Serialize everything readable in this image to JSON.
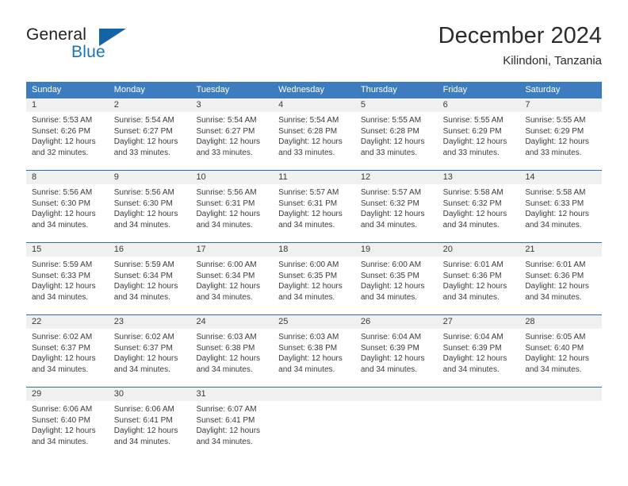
{
  "brand": {
    "name_part1": "General",
    "name_part2": "Blue",
    "triangle_color": "#1364a5",
    "blue_color": "#1a72bb"
  },
  "header": {
    "month_title": "December 2024",
    "location": "Kilindoni, Tanzania"
  },
  "calendar": {
    "header_bg": "#3d7dbf",
    "daynum_bg": "#f0f0f0",
    "row_divider": "#2f6daf",
    "weekdays": [
      "Sunday",
      "Monday",
      "Tuesday",
      "Wednesday",
      "Thursday",
      "Friday",
      "Saturday"
    ],
    "weeks": [
      [
        {
          "day": "1",
          "sunrise": "Sunrise: 5:53 AM",
          "sunset": "Sunset: 6:26 PM",
          "daylight_line1": "Daylight: 12 hours",
          "daylight_line2": "and 32 minutes."
        },
        {
          "day": "2",
          "sunrise": "Sunrise: 5:54 AM",
          "sunset": "Sunset: 6:27 PM",
          "daylight_line1": "Daylight: 12 hours",
          "daylight_line2": "and 33 minutes."
        },
        {
          "day": "3",
          "sunrise": "Sunrise: 5:54 AM",
          "sunset": "Sunset: 6:27 PM",
          "daylight_line1": "Daylight: 12 hours",
          "daylight_line2": "and 33 minutes."
        },
        {
          "day": "4",
          "sunrise": "Sunrise: 5:54 AM",
          "sunset": "Sunset: 6:28 PM",
          "daylight_line1": "Daylight: 12 hours",
          "daylight_line2": "and 33 minutes."
        },
        {
          "day": "5",
          "sunrise": "Sunrise: 5:55 AM",
          "sunset": "Sunset: 6:28 PM",
          "daylight_line1": "Daylight: 12 hours",
          "daylight_line2": "and 33 minutes."
        },
        {
          "day": "6",
          "sunrise": "Sunrise: 5:55 AM",
          "sunset": "Sunset: 6:29 PM",
          "daylight_line1": "Daylight: 12 hours",
          "daylight_line2": "and 33 minutes."
        },
        {
          "day": "7",
          "sunrise": "Sunrise: 5:55 AM",
          "sunset": "Sunset: 6:29 PM",
          "daylight_line1": "Daylight: 12 hours",
          "daylight_line2": "and 33 minutes."
        }
      ],
      [
        {
          "day": "8",
          "sunrise": "Sunrise: 5:56 AM",
          "sunset": "Sunset: 6:30 PM",
          "daylight_line1": "Daylight: 12 hours",
          "daylight_line2": "and 34 minutes."
        },
        {
          "day": "9",
          "sunrise": "Sunrise: 5:56 AM",
          "sunset": "Sunset: 6:30 PM",
          "daylight_line1": "Daylight: 12 hours",
          "daylight_line2": "and 34 minutes."
        },
        {
          "day": "10",
          "sunrise": "Sunrise: 5:56 AM",
          "sunset": "Sunset: 6:31 PM",
          "daylight_line1": "Daylight: 12 hours",
          "daylight_line2": "and 34 minutes."
        },
        {
          "day": "11",
          "sunrise": "Sunrise: 5:57 AM",
          "sunset": "Sunset: 6:31 PM",
          "daylight_line1": "Daylight: 12 hours",
          "daylight_line2": "and 34 minutes."
        },
        {
          "day": "12",
          "sunrise": "Sunrise: 5:57 AM",
          "sunset": "Sunset: 6:32 PM",
          "daylight_line1": "Daylight: 12 hours",
          "daylight_line2": "and 34 minutes."
        },
        {
          "day": "13",
          "sunrise": "Sunrise: 5:58 AM",
          "sunset": "Sunset: 6:32 PM",
          "daylight_line1": "Daylight: 12 hours",
          "daylight_line2": "and 34 minutes."
        },
        {
          "day": "14",
          "sunrise": "Sunrise: 5:58 AM",
          "sunset": "Sunset: 6:33 PM",
          "daylight_line1": "Daylight: 12 hours",
          "daylight_line2": "and 34 minutes."
        }
      ],
      [
        {
          "day": "15",
          "sunrise": "Sunrise: 5:59 AM",
          "sunset": "Sunset: 6:33 PM",
          "daylight_line1": "Daylight: 12 hours",
          "daylight_line2": "and 34 minutes."
        },
        {
          "day": "16",
          "sunrise": "Sunrise: 5:59 AM",
          "sunset": "Sunset: 6:34 PM",
          "daylight_line1": "Daylight: 12 hours",
          "daylight_line2": "and 34 minutes."
        },
        {
          "day": "17",
          "sunrise": "Sunrise: 6:00 AM",
          "sunset": "Sunset: 6:34 PM",
          "daylight_line1": "Daylight: 12 hours",
          "daylight_line2": "and 34 minutes."
        },
        {
          "day": "18",
          "sunrise": "Sunrise: 6:00 AM",
          "sunset": "Sunset: 6:35 PM",
          "daylight_line1": "Daylight: 12 hours",
          "daylight_line2": "and 34 minutes."
        },
        {
          "day": "19",
          "sunrise": "Sunrise: 6:00 AM",
          "sunset": "Sunset: 6:35 PM",
          "daylight_line1": "Daylight: 12 hours",
          "daylight_line2": "and 34 minutes."
        },
        {
          "day": "20",
          "sunrise": "Sunrise: 6:01 AM",
          "sunset": "Sunset: 6:36 PM",
          "daylight_line1": "Daylight: 12 hours",
          "daylight_line2": "and 34 minutes."
        },
        {
          "day": "21",
          "sunrise": "Sunrise: 6:01 AM",
          "sunset": "Sunset: 6:36 PM",
          "daylight_line1": "Daylight: 12 hours",
          "daylight_line2": "and 34 minutes."
        }
      ],
      [
        {
          "day": "22",
          "sunrise": "Sunrise: 6:02 AM",
          "sunset": "Sunset: 6:37 PM",
          "daylight_line1": "Daylight: 12 hours",
          "daylight_line2": "and 34 minutes."
        },
        {
          "day": "23",
          "sunrise": "Sunrise: 6:02 AM",
          "sunset": "Sunset: 6:37 PM",
          "daylight_line1": "Daylight: 12 hours",
          "daylight_line2": "and 34 minutes."
        },
        {
          "day": "24",
          "sunrise": "Sunrise: 6:03 AM",
          "sunset": "Sunset: 6:38 PM",
          "daylight_line1": "Daylight: 12 hours",
          "daylight_line2": "and 34 minutes."
        },
        {
          "day": "25",
          "sunrise": "Sunrise: 6:03 AM",
          "sunset": "Sunset: 6:38 PM",
          "daylight_line1": "Daylight: 12 hours",
          "daylight_line2": "and 34 minutes."
        },
        {
          "day": "26",
          "sunrise": "Sunrise: 6:04 AM",
          "sunset": "Sunset: 6:39 PM",
          "daylight_line1": "Daylight: 12 hours",
          "daylight_line2": "and 34 minutes."
        },
        {
          "day": "27",
          "sunrise": "Sunrise: 6:04 AM",
          "sunset": "Sunset: 6:39 PM",
          "daylight_line1": "Daylight: 12 hours",
          "daylight_line2": "and 34 minutes."
        },
        {
          "day": "28",
          "sunrise": "Sunrise: 6:05 AM",
          "sunset": "Sunset: 6:40 PM",
          "daylight_line1": "Daylight: 12 hours",
          "daylight_line2": "and 34 minutes."
        }
      ],
      [
        {
          "day": "29",
          "sunrise": "Sunrise: 6:06 AM",
          "sunset": "Sunset: 6:40 PM",
          "daylight_line1": "Daylight: 12 hours",
          "daylight_line2": "and 34 minutes."
        },
        {
          "day": "30",
          "sunrise": "Sunrise: 6:06 AM",
          "sunset": "Sunset: 6:41 PM",
          "daylight_line1": "Daylight: 12 hours",
          "daylight_line2": "and 34 minutes."
        },
        {
          "day": "31",
          "sunrise": "Sunrise: 6:07 AM",
          "sunset": "Sunset: 6:41 PM",
          "daylight_line1": "Daylight: 12 hours",
          "daylight_line2": "and 34 minutes."
        },
        {
          "day": "",
          "sunrise": "",
          "sunset": "",
          "daylight_line1": "",
          "daylight_line2": ""
        },
        {
          "day": "",
          "sunrise": "",
          "sunset": "",
          "daylight_line1": "",
          "daylight_line2": ""
        },
        {
          "day": "",
          "sunrise": "",
          "sunset": "",
          "daylight_line1": "",
          "daylight_line2": ""
        },
        {
          "day": "",
          "sunrise": "",
          "sunset": "",
          "daylight_line1": "",
          "daylight_line2": ""
        }
      ]
    ]
  }
}
